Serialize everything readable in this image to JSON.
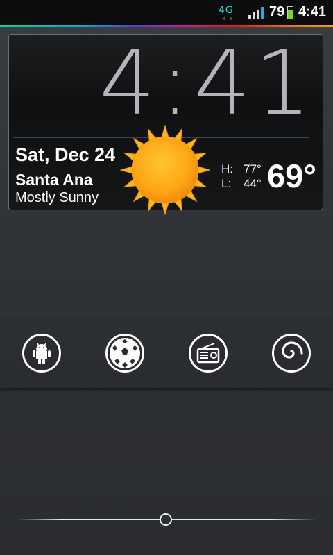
{
  "status_bar": {
    "network": "4G",
    "battery_percent": "79",
    "battery_level": 0.79,
    "time": "4:41"
  },
  "widget": {
    "clock": "4:41",
    "date": "Sat, Dec 24",
    "city": "Santa Ana",
    "condition": "Mostly Sunny",
    "high_label": "H:",
    "high": "77°",
    "low_label": "L:",
    "low": "44°",
    "current_temp": "69°",
    "weather_icon": "sun-icon"
  },
  "dock": {
    "apps": [
      {
        "icon": "android-icon"
      },
      {
        "icon": "soccer-ball-icon"
      },
      {
        "icon": "radio-icon"
      },
      {
        "icon": "spiral-icon"
      }
    ]
  },
  "unlock": {
    "slider_position": 0.5
  }
}
